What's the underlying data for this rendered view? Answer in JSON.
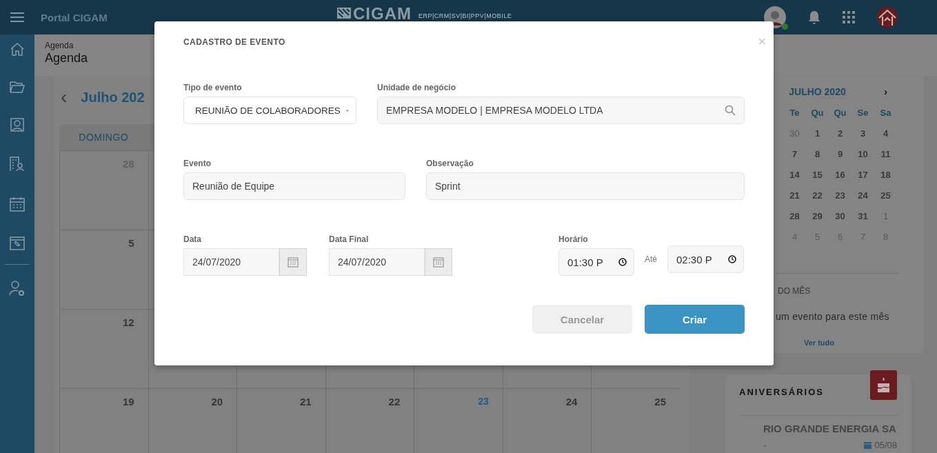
{
  "topbar": {
    "title": "Portal CIGAM",
    "logo": "CIGAM",
    "logo_subtitle": "ERP|CRM|SV|BI|PPV|MOBILE",
    "user_online": true
  },
  "breadcrumb": "Agenda",
  "page_title": "Agenda",
  "calendar": {
    "prev": "‹",
    "month": "Julho 202",
    "weekdays": [
      "DOMINGO"
    ],
    "weeks": [
      {
        "days": [
          {
            "day": "28",
            "muted": true,
            "today": false
          }
        ]
      },
      {
        "days": [
          {
            "day": "5",
            "muted": false,
            "today": false
          }
        ]
      },
      {
        "days": [
          {
            "day": "12",
            "muted": false,
            "today": false
          }
        ]
      },
      {
        "days": [
          {
            "day": "19",
            "muted": false,
            "today": false
          },
          {
            "day": "20",
            "muted": false,
            "today": false
          },
          {
            "day": "21",
            "muted": false,
            "today": false
          },
          {
            "day": "22",
            "muted": false,
            "today": false
          },
          {
            "day": "23",
            "muted": false,
            "today": true
          },
          {
            "day": "24",
            "muted": false,
            "today": false
          },
          {
            "day": "25",
            "muted": false,
            "today": false
          }
        ]
      }
    ]
  },
  "mini_calendar": {
    "title": "JULHO 2020",
    "next": "›",
    "weekdays": [
      "Te",
      "Qu",
      "Qu",
      "Se",
      "Sa"
    ],
    "weeks": [
      [
        {
          "day": "30",
          "muted": true
        },
        {
          "day": "1",
          "muted": false
        },
        {
          "day": "2",
          "muted": false
        },
        {
          "day": "3",
          "muted": false
        },
        {
          "day": "4",
          "muted": false
        }
      ],
      [
        {
          "day": "7",
          "muted": false
        },
        {
          "day": "8",
          "muted": false
        },
        {
          "day": "9",
          "muted": false
        },
        {
          "day": "10",
          "muted": false
        },
        {
          "day": "11",
          "muted": false
        }
      ],
      [
        {
          "day": "14",
          "muted": false
        },
        {
          "day": "15",
          "muted": false
        },
        {
          "day": "16",
          "muted": false
        },
        {
          "day": "17",
          "muted": false
        },
        {
          "day": "18",
          "muted": false
        }
      ],
      [
        {
          "day": "21",
          "muted": false
        },
        {
          "day": "22",
          "muted": false
        },
        {
          "day": "23",
          "muted": false
        },
        {
          "day": "24",
          "muted": false
        },
        {
          "day": "25",
          "muted": false
        }
      ],
      [
        {
          "day": "28",
          "muted": false
        },
        {
          "day": "29",
          "muted": false
        },
        {
          "day": "30",
          "muted": false
        },
        {
          "day": "31",
          "muted": false
        },
        {
          "day": "1",
          "muted": true
        }
      ],
      [
        {
          "day": "4",
          "muted": true
        },
        {
          "day": "5",
          "muted": true
        },
        {
          "day": "6",
          "muted": true
        },
        {
          "day": "7",
          "muted": true
        },
        {
          "day": "8",
          "muted": true
        }
      ]
    ]
  },
  "events": {
    "title": "DO MÊS",
    "empty": "um evento para este mês",
    "link": "Ver tudo"
  },
  "birthdays": {
    "title": "ANIVERSÁRIOS",
    "items": [
      {
        "name": "RIO GRANDE ENERGIA SA",
        "detail": "-",
        "date": "05/08"
      }
    ]
  },
  "modal": {
    "title": "CADASTRO DE EVENTO",
    "close": "×",
    "rows": [
      [
        {
          "kind": "select",
          "label": "Tipo de evento",
          "value": "REUNIÃO DE COLABORADORES"
        },
        {
          "kind": "search",
          "label": "Unidade de negócio",
          "value": "EMPRESA MODELO | EMPRESA MODELO LTDA"
        }
      ],
      [
        {
          "kind": "text",
          "label": "Evento",
          "value": "Reunião de Equipe"
        },
        {
          "kind": "text",
          "label": "Observação",
          "value": "Sprint"
        }
      ],
      [
        {
          "kind": "date",
          "label": "Data",
          "value": "24/07/2020"
        },
        {
          "kind": "date",
          "label": "Data Final",
          "value": "24/07/2020"
        },
        {
          "kind": "time_range",
          "label": "Horário",
          "value": "01:30 P",
          "separator": "Até",
          "value_to": "02:30 P"
        }
      ]
    ],
    "buttons": [
      {
        "label": "Cancelar",
        "primary": false
      },
      {
        "label": "Criar",
        "primary": true
      }
    ]
  }
}
